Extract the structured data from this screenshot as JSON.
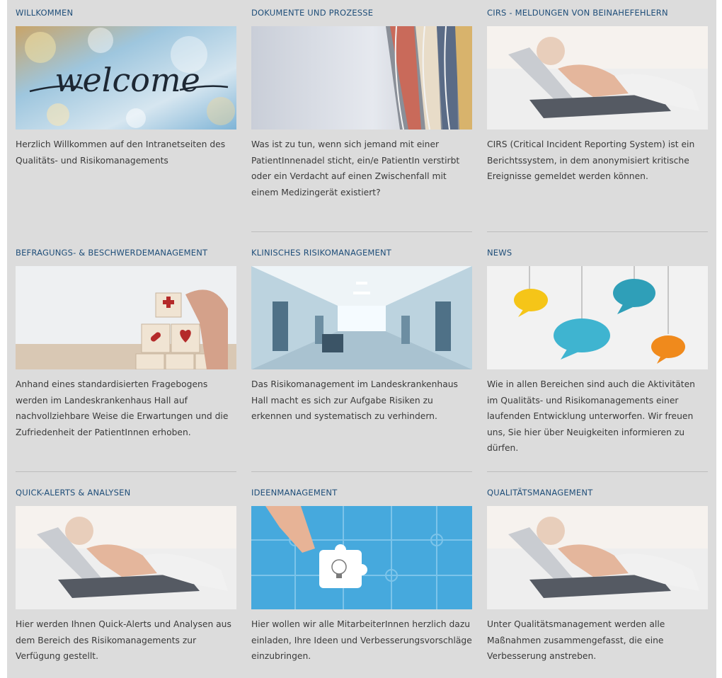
{
  "tiles": [
    {
      "title": "WILLKOMMEN",
      "image": "welcome-handwriting-image",
      "image_text": "welcome",
      "description": "Herzlich Willkommen auf den Intranetseiten des Qualitäts- und Risikomanagements"
    },
    {
      "title": "DOKUMENTE UND PROZESSE",
      "image": "magazine-pages-image",
      "description": "Was ist zu tun, wenn sich jemand mit einer PatientInnenadel sticht, ein/e PatientIn verstirbt oder ein Verdacht auf einen Zwischenfall mit einem Medizingerät existiert?"
    },
    {
      "title": "CIRS - MELDUNGEN VON BEINAHEFEHLERN",
      "image": "laptop-typing-image",
      "description": "CIRS (Critical Incident Reporting System) ist ein Berichtssystem, in dem anonymisiert kritische Ereignisse gemeldet werden können."
    },
    {
      "title": "BEFRAGUNGS- & BESCHWERDEMANAGEMENT",
      "image": "medical-blocks-image",
      "description": "Anhand eines standardisierten Fragebogens werden im Landeskrankenhaus Hall auf nachvollziehbare Weise die Erwartungen und die Zufriedenheit der PatientInnen erhoben."
    },
    {
      "title": "KLINISCHES RISIKOMANAGEMENT",
      "image": "hospital-corridor-image",
      "description": "Das Risikomanagement im Landeskrankenhaus Hall macht es sich zur Aufgabe Risiken zu erkennen und systematisch zu verhindern."
    },
    {
      "title": "NEWS",
      "image": "speech-bubbles-image",
      "description": "Wie in allen Bereichen sind auch die Aktivitäten im Qualitäts- und Risikomanagements einer laufenden Entwicklung unterworfen. Wir freuen uns, Sie hier über Neuigkeiten informieren zu dürfen."
    },
    {
      "title": "QUICK-ALERTS & ANALYSEN",
      "image": "laptop-typing-image",
      "description": "Hier werden Ihnen Quick-Alerts und Analysen aus dem Bereich des Risikomanagements zur Verfügung gestellt."
    },
    {
      "title": "IDEENMANAGEMENT",
      "image": "puzzle-piece-image",
      "description": "Hier wollen wir alle MitarbeiterInnen herzlich dazu einladen, Ihre Ideen und Verbesserungsvorschläge einzubringen."
    },
    {
      "title": "QUALITÄTSMANAGEMENT",
      "image": "laptop-typing-image",
      "description": "Unter Qualitätsmanagement werden alle Maßnahmen zusammengefasst, die eine Verbesserung anstreben."
    }
  ],
  "colors": {
    "heading": "#1f4e79",
    "body_text": "#3a3a3a",
    "panel_background": "#dcdcdc",
    "divider": "#bdbdbd"
  }
}
